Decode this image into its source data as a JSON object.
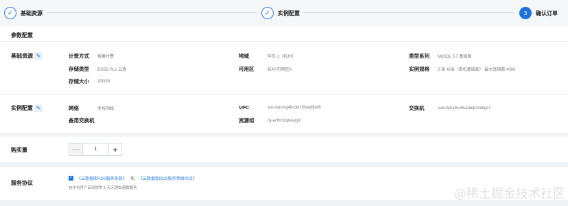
{
  "steps": [
    {
      "number": "✓",
      "label": "基础资源"
    },
    {
      "number": "✓",
      "label": "实例配置"
    },
    {
      "number": "3",
      "label": "确认订单"
    }
  ],
  "params": {
    "title": "参数配置",
    "basic": {
      "heading": "基础资源",
      "items": [
        {
          "key": "计费方式",
          "value": "按量付费"
        },
        {
          "key": "存储类型",
          "value": "ESSD PL1 云盘"
        },
        {
          "key": "存储大小",
          "value": "100GB"
        },
        {
          "key": "地域",
          "value": "华东 1（杭州）"
        },
        {
          "key": "可用区",
          "value": "杭州 可用区K"
        },
        {
          "key": "类型系列",
          "value": "MySQL  5.7 基础版"
        },
        {
          "key": "实例规格",
          "value": "2 核 4GB（单机基础款）  最大连接数:4000"
        }
      ]
    },
    "instance": {
      "heading": "实例配置",
      "items": [
        {
          "key": "网络",
          "value": "专有网络"
        },
        {
          "key": "备用交换机",
          "value": ""
        },
        {
          "key": "VPC",
          "value": "vpc-bp1mg4bo3n1t0owj6jwfb"
        },
        {
          "key": "资源组",
          "value": "rg-acfm3cqtasxjyti"
        },
        {
          "key": "交换机",
          "value": "vsw-bp1p5c45ao8dpvlmltgz7"
        }
      ]
    }
  },
  "quantity": {
    "label": "购买量",
    "minus": "—",
    "value": "1",
    "plus": "+"
  },
  "terms": {
    "label": "服务协议",
    "check": "✓",
    "link1": "《云数据库RDS服务条款》",
    "and": "和",
    "link2": "《云数据库RDS服务等级协议》",
    "note": "包年包月产品仅提供 5 天无理由退款服务"
  },
  "watermark": "@稀土掘金技术社区",
  "icons": {
    "edit": "pencil-icon",
    "check": "check-icon"
  },
  "colors": {
    "accent": "#1f73d8",
    "link": "#2a7de1"
  }
}
